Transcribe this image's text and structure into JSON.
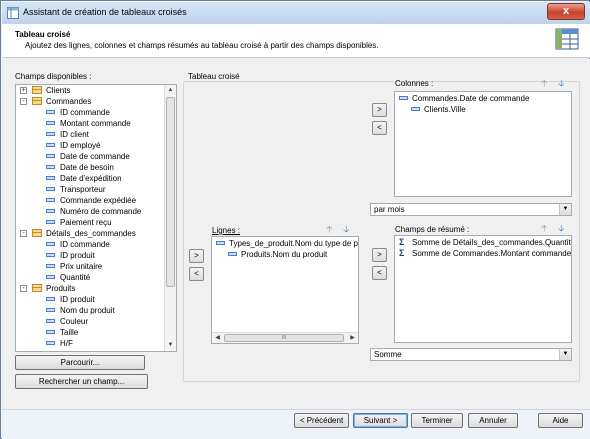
{
  "window": {
    "title": "Assistant de création de tableaux croisés",
    "close_label": "x"
  },
  "header": {
    "title": "Tableau croisé",
    "description": "Ajoutez des lignes, colonnes et champs résumés au tableau croisé à partir des champs disponibles."
  },
  "available": {
    "label": "Champs disponibles :",
    "items": [
      {
        "label": "Clients",
        "type": "table",
        "expander": "+"
      },
      {
        "label": "Commandes",
        "type": "table",
        "expander": "-"
      },
      {
        "label": "ID commande",
        "type": "field"
      },
      {
        "label": "Montant commande",
        "type": "field"
      },
      {
        "label": "ID client",
        "type": "field"
      },
      {
        "label": "ID employé",
        "type": "field"
      },
      {
        "label": "Date de commande",
        "type": "field"
      },
      {
        "label": "Date de besoin",
        "type": "field"
      },
      {
        "label": "Date d'expédition",
        "type": "field"
      },
      {
        "label": "Transporteur",
        "type": "field"
      },
      {
        "label": "Commande expédiée",
        "type": "field"
      },
      {
        "label": "Numéro de commande",
        "type": "field"
      },
      {
        "label": "Paiement reçu",
        "type": "field"
      },
      {
        "label": "Détails_des_commandes",
        "type": "table",
        "expander": "-"
      },
      {
        "label": "ID commande",
        "type": "field"
      },
      {
        "label": "ID produit",
        "type": "field"
      },
      {
        "label": "Prix unitaire",
        "type": "field"
      },
      {
        "label": "Quantité",
        "type": "field"
      },
      {
        "label": "Produits",
        "type": "table",
        "expander": "-"
      },
      {
        "label": "ID produit",
        "type": "field"
      },
      {
        "label": "Nom du produit",
        "type": "field"
      },
      {
        "label": "Couleur",
        "type": "field"
      },
      {
        "label": "Taille",
        "type": "field"
      },
      {
        "label": "H/F",
        "type": "field"
      }
    ],
    "browse_label": "Parcourir...",
    "search_label": "Rechercher un champ..."
  },
  "pivot": {
    "group_label": "Tableau croisé",
    "columns": {
      "label": "Colonnes :",
      "items": [
        "Commandes.Date de commande",
        "Clients.Ville"
      ],
      "combo_value": "par mois"
    },
    "rows": {
      "label": "Lignes :",
      "items": [
        "Types_de_produit.Nom du type de produit",
        "Produits.Nom du produit"
      ]
    },
    "summary": {
      "label": "Champs de résumé :",
      "items": [
        "Somme de Détails_des_commandes.Quantité",
        "Somme de Commandes.Montant commande"
      ],
      "combo_value": "Somme"
    }
  },
  "buttons": {
    "add": ">",
    "remove": "<",
    "prev": "< Précédent",
    "next": "Suivant >",
    "finish": "Terminer",
    "cancel": "Annuler",
    "help": "Aide"
  },
  "glyphs": {
    "up": "🡡",
    "down": "🡣",
    "combo_arrow": "▼",
    "scroll_up": "▲",
    "scroll_down": "▼",
    "scroll_left": "◀",
    "scroll_right": "▶",
    "grip": "III",
    "sigma": "Σ"
  }
}
